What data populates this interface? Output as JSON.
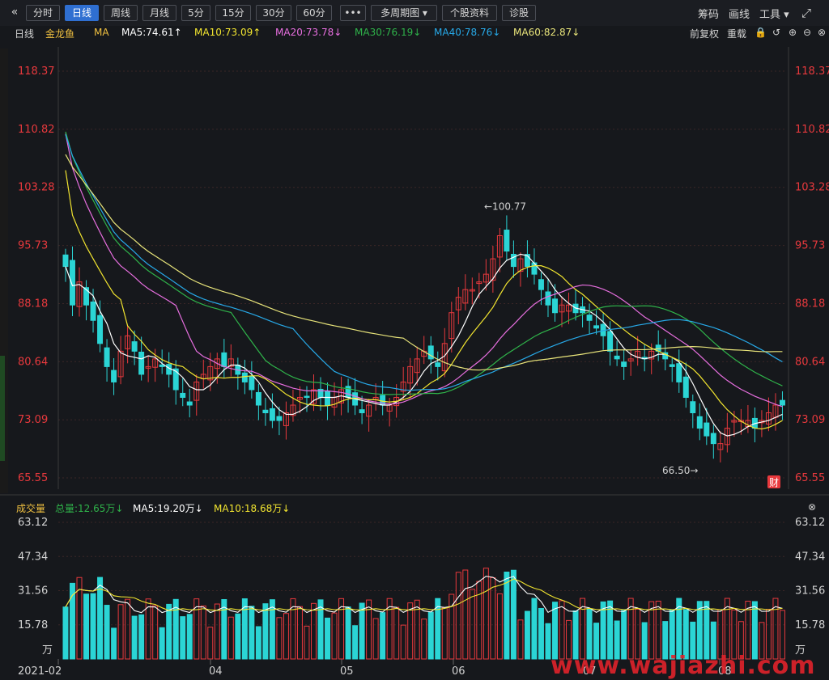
{
  "toolbar": {
    "back_icon": "double-chevron-left-icon",
    "buttons": [
      "分时",
      "日线",
      "周线",
      "月线",
      "5分",
      "15分",
      "30分",
      "60分",
      "•••",
      "多周期图 ▾",
      "个股资料",
      "诊股"
    ],
    "active": "日线",
    "right_items": [
      "筹码",
      "画线",
      "工具 ▾"
    ],
    "expand_icon": "expand-icon"
  },
  "ma_bar": {
    "period": "日线",
    "stock": "金龙鱼",
    "indicator": "MA",
    "items": [
      {
        "label": "MA5:74.61↑",
        "color": "#ffffff"
      },
      {
        "label": "MA10:73.09↑",
        "color": "#f2e530"
      },
      {
        "label": "MA20:73.78↓",
        "color": "#e86fe0"
      },
      {
        "label": "MA30:76.19↓",
        "color": "#2fb34a"
      },
      {
        "label": "MA40:78.76↓",
        "color": "#27a9e8"
      },
      {
        "label": "MA60:82.87↓",
        "color": "#e8e47a"
      }
    ],
    "right": [
      "前复权",
      "重载"
    ],
    "right_icons": [
      "lock-icon",
      "undo-icon",
      "zoom-in-icon",
      "zoom-out-icon",
      "close-icon"
    ]
  },
  "price_axis": [
    "118.37",
    "110.82",
    "103.28",
    "95.73",
    "88.18",
    "80.64",
    "73.09",
    "65.55"
  ],
  "annotations": {
    "high": "←100.77",
    "low": "66.50→"
  },
  "fin_badge": "财",
  "volume": {
    "title": "成交量",
    "total": "总量:12.65万↓",
    "ma5": "MA5:19.20万↓",
    "ma10": "MA10:18.68万↓",
    "axis": [
      "63.12",
      "47.34",
      "31.56",
      "15.78"
    ],
    "unit": "万",
    "close_icon": "close-icon"
  },
  "x_axis": [
    "2021-02",
    "04",
    "05",
    "06",
    "07",
    "08"
  ],
  "watermark": "www.wajiazhi.com",
  "colors": {
    "up": "#e8393d",
    "down": "#2bd5d5",
    "bg": "#16181c",
    "grid": "#3a2626"
  },
  "chart_data": {
    "type": "candlestick",
    "title": "金龙鱼 日线",
    "ylim": [
      65.55,
      118.37
    ],
    "high": 100.77,
    "low": 66.5,
    "closes": [
      93,
      88,
      91,
      88,
      86,
      83,
      80,
      78,
      82,
      84,
      82,
      79,
      80,
      81,
      80,
      79,
      77,
      76,
      75,
      78,
      79,
      80,
      81,
      80,
      81,
      79,
      78,
      77,
      75,
      74,
      73,
      73,
      74,
      75,
      76,
      76,
      77,
      76,
      75,
      76,
      77,
      76,
      75,
      74,
      75,
      76,
      75,
      75,
      76,
      78,
      80,
      81,
      82,
      81,
      80,
      83,
      87,
      89,
      90,
      90,
      91,
      92,
      94,
      97,
      95,
      93,
      94,
      93,
      92,
      90,
      88,
      87,
      88,
      88,
      87,
      87,
      86,
      85,
      84,
      82,
      81,
      80,
      81,
      82,
      81,
      82,
      82,
      81,
      80,
      78,
      76,
      74,
      72,
      71,
      70,
      70,
      72,
      73,
      73,
      73,
      72,
      73,
      74,
      75,
      75
    ]
  }
}
